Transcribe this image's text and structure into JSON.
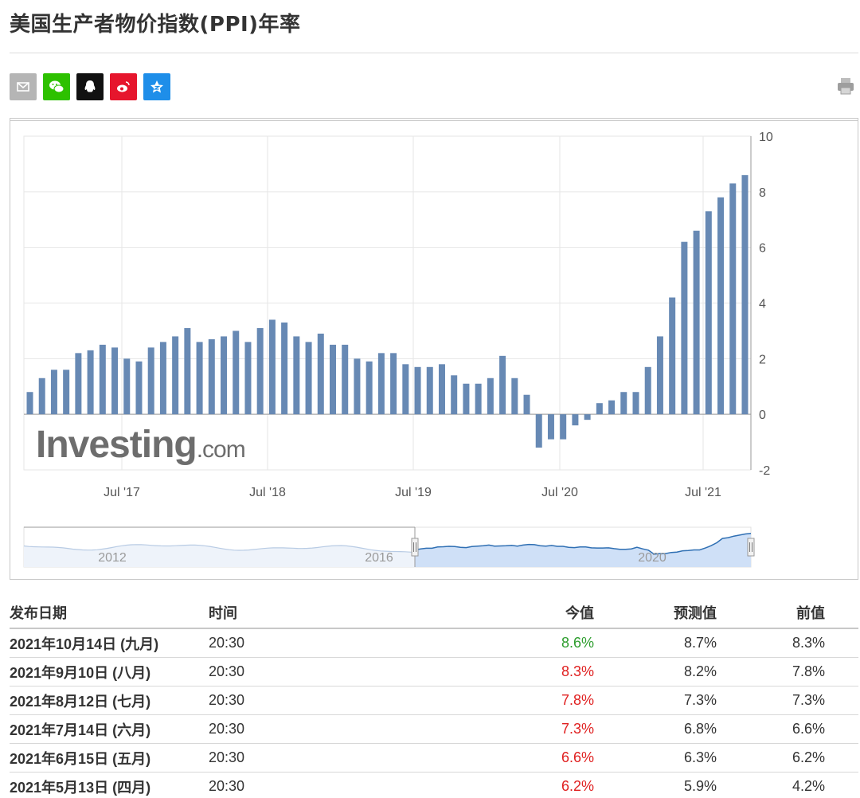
{
  "page": {
    "title": "美国生产者物价指数(PPI)年率"
  },
  "share": {
    "icons": [
      "email-icon",
      "wechat-icon",
      "qq-icon",
      "weibo-icon",
      "qzone-icon"
    ],
    "colors": {
      "email": "#b5b5b5",
      "wechat": "#2dc100",
      "qq": "#111111",
      "weibo": "#e6162d",
      "qzone": "#1e8ee9"
    }
  },
  "print": {
    "icon": "print-icon"
  },
  "chart_data": {
    "type": "bar",
    "color": "#6789b4",
    "x_tick_labels": [
      "Jul '17",
      "Jul '18",
      "Jul '19",
      "Jul '20",
      "Jul '21"
    ],
    "y_tick_labels": [
      "10",
      "8",
      "6",
      "4",
      "2",
      "0",
      "-2"
    ],
    "ylim": [
      -2,
      10
    ],
    "grid": true,
    "watermark": "Investing.com",
    "values": [
      0.8,
      1.3,
      1.6,
      1.6,
      2.2,
      2.3,
      2.5,
      2.4,
      2.0,
      1.9,
      2.4,
      2.6,
      2.8,
      3.1,
      2.6,
      2.7,
      2.8,
      3.0,
      2.6,
      3.1,
      3.4,
      3.3,
      2.8,
      2.6,
      2.9,
      2.5,
      2.5,
      2.0,
      1.9,
      2.2,
      2.2,
      1.8,
      1.7,
      1.7,
      1.8,
      1.4,
      1.1,
      1.1,
      1.3,
      2.1,
      1.3,
      0.7,
      -1.2,
      -0.9,
      -0.9,
      -0.4,
      -0.2,
      0.4,
      0.5,
      0.8,
      0.8,
      1.7,
      2.8,
      4.2,
      6.2,
      6.6,
      7.3,
      7.8,
      8.3,
      8.6
    ],
    "navigator": {
      "year_labels": [
        "2012",
        "2016",
        "2020"
      ]
    }
  },
  "table": {
    "headers": {
      "date": "发布日期",
      "time": "时间",
      "actual": "今值",
      "forecast": "预测值",
      "previous": "前值"
    },
    "rows": [
      {
        "date": "2021年10月14日 (九月)",
        "time": "20:30",
        "actual": "8.6%",
        "actual_color": "#2d9d2d",
        "forecast": "8.7%",
        "previous": "8.3%"
      },
      {
        "date": "2021年9月10日 (八月)",
        "time": "20:30",
        "actual": "8.3%",
        "actual_color": "#e02020",
        "forecast": "8.2%",
        "previous": "7.8%"
      },
      {
        "date": "2021年8月12日 (七月)",
        "time": "20:30",
        "actual": "7.8%",
        "actual_color": "#e02020",
        "forecast": "7.3%",
        "previous": "7.3%"
      },
      {
        "date": "2021年7月14日 (六月)",
        "time": "20:30",
        "actual": "7.3%",
        "actual_color": "#e02020",
        "forecast": "6.8%",
        "previous": "6.6%"
      },
      {
        "date": "2021年6月15日 (五月)",
        "time": "20:30",
        "actual": "6.6%",
        "actual_color": "#e02020",
        "forecast": "6.3%",
        "previous": "6.2%"
      },
      {
        "date": "2021年5月13日 (四月)",
        "time": "20:30",
        "actual": "6.2%",
        "actual_color": "#e02020",
        "forecast": "5.9%",
        "previous": "4.2%"
      }
    ]
  }
}
